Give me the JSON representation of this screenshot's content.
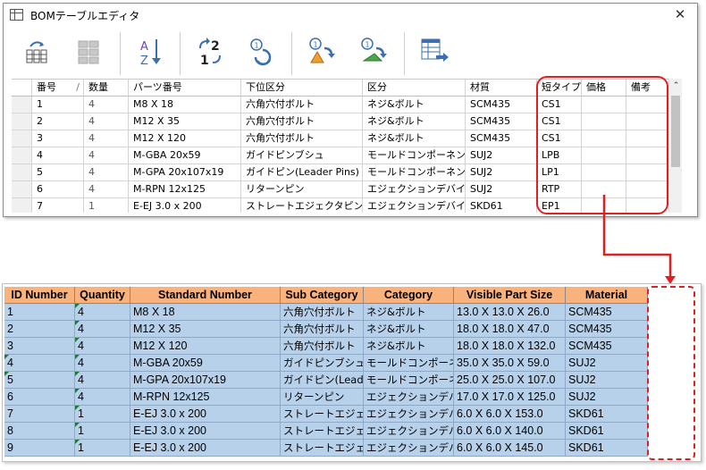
{
  "window": {
    "title": "BOMテーブルエディタ",
    "close": "✕"
  },
  "toolbar": {
    "buttons": [
      {
        "name": "import-columns-button",
        "icon": "columns-import-icon"
      },
      {
        "name": "grid-layout-button",
        "icon": "grid-layout-icon"
      },
      {
        "name": "sort-az-button",
        "icon": "sort-az-icon"
      },
      {
        "name": "sort-numeric-button",
        "icon": "sort-12-icon"
      },
      {
        "name": "renumber-button",
        "icon": "renumber-icon"
      },
      {
        "name": "renumber-a-button",
        "icon": "renumber-warning-icon"
      },
      {
        "name": "renumber-b-button",
        "icon": "renumber-green-icon"
      },
      {
        "name": "export-table-button",
        "icon": "export-table-icon"
      }
    ]
  },
  "grid": {
    "headers": [
      "番号",
      "数量",
      "パーツ番号",
      "下位区分",
      "区分",
      "材質",
      "短タイプ",
      "価格",
      "備考"
    ],
    "sort_indicator": "/",
    "rows": [
      [
        "1",
        "4",
        "M8 X 18",
        "六角穴付ボルト",
        "ネジ&ボルト",
        "SCM435",
        "CS1",
        "",
        ""
      ],
      [
        "2",
        "4",
        "M12 X 35",
        "六角穴付ボルト",
        "ネジ&ボルト",
        "SCM435",
        "CS1",
        "",
        ""
      ],
      [
        "3",
        "4",
        "M12 X 120",
        "六角穴付ボルト",
        "ネジ&ボルト",
        "SCM435",
        "CS1",
        "",
        ""
      ],
      [
        "4",
        "4",
        "M-GBA 20x59",
        "ガイドピンブシュ",
        "モールドコンポーネント",
        "SUJ2",
        "LPB",
        "",
        ""
      ],
      [
        "5",
        "4",
        "M-GPA 20x107x19",
        "ガイドピン(Leader Pins)",
        "モールドコンポーネント",
        "SUJ2",
        "LP1",
        "",
        ""
      ],
      [
        "6",
        "4",
        "M-RPN 12x125",
        "リターンピン",
        "エジェクションデバイス",
        "SUJ2",
        "RTP",
        "",
        ""
      ],
      [
        "7",
        "1",
        "E-EJ 3.0 x 200",
        "ストレートエジェクタピン",
        "エジェクションデバイス",
        "SKD61",
        "EP1",
        "",
        ""
      ]
    ],
    "scroll_up": "⌃"
  },
  "sheet": {
    "headers": [
      "ID Number",
      "Quantity",
      "Standard Number",
      "Sub Category",
      "Category",
      "Visible Part Size",
      "Material"
    ],
    "rows": [
      [
        "1",
        "4",
        "M8 X 18",
        "六角穴付ボルト",
        "ネジ&ボルト",
        "13.0 X 13.0 X 26.0",
        "SCM435"
      ],
      [
        "2",
        "4",
        "M12 X 35",
        "六角穴付ボルト",
        "ネジ&ボルト",
        "18.0 X 18.0 X 47.0",
        "SCM435"
      ],
      [
        "3",
        "4",
        "M12 X 120",
        "六角穴付ボルト",
        "ネジ&ボルト",
        "18.0 X 18.0 X 132.0",
        "SCM435"
      ],
      [
        "4",
        "4",
        "M-GBA 20x59",
        "ガイドピンブシュ",
        "モールドコンポーネント",
        "35.0 X 35.0 X 59.0",
        "SUJ2"
      ],
      [
        "5",
        "4",
        "M-GPA 20x107x19",
        "ガイドピン(Leader",
        "モールドコンポーネント",
        "25.0 X 25.0 X 107.0",
        "SUJ2"
      ],
      [
        "6",
        "4",
        "M-RPN 12x125",
        "リターンピン",
        "エジェクションデバイス",
        "17.0 X 17.0 X 125.0",
        "SUJ2"
      ],
      [
        "7",
        "1",
        "E-EJ 3.0 x 200",
        "ストレートエジェクタピン",
        "エジェクションデバイス",
        "6.0 X 6.0 X 153.0",
        "SKD61"
      ],
      [
        "8",
        "1",
        "E-EJ 3.0 x 200",
        "ストレートエジェクタピン",
        "エジェクションデバイス",
        "6.0 X 6.0 X 140.0",
        "SKD61"
      ],
      [
        "9",
        "1",
        "E-EJ 3.0 x 200",
        "ストレートエジェクタピン",
        "エジェクションデバイス",
        "6.0 X 6.0 X 145.0",
        "SKD61"
      ]
    ]
  },
  "colors": {
    "highlight_red": "#e02020",
    "sheet_header": "#f9b27c",
    "sheet_cell": "#b8d1ea"
  }
}
